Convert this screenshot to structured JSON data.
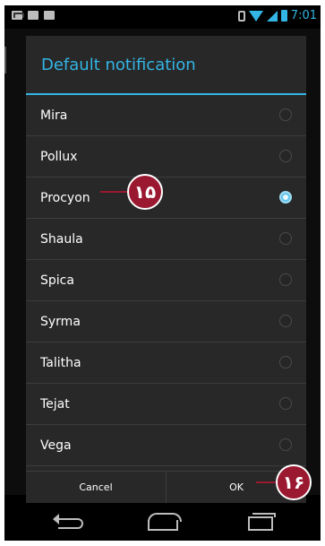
{
  "status_bar": {
    "time": "7:01",
    "left_icons": [
      "gmail-icon",
      "chat-icon",
      "voicemail-icon"
    ],
    "right_icons": [
      "vibrate-icon",
      "wifi-icon",
      "signal-icon",
      "battery-icon"
    ]
  },
  "dialog": {
    "title": "Default notification",
    "items": [
      {
        "label": "Mira",
        "selected": false
      },
      {
        "label": "Pollux",
        "selected": false
      },
      {
        "label": "Procyon",
        "selected": true
      },
      {
        "label": "Shaula",
        "selected": false
      },
      {
        "label": "Spica",
        "selected": false
      },
      {
        "label": "Syrma",
        "selected": false
      },
      {
        "label": "Talitha",
        "selected": false
      },
      {
        "label": "Tejat",
        "selected": false
      },
      {
        "label": "Vega",
        "selected": false
      }
    ],
    "cancel_label": "Cancel",
    "ok_label": "OK"
  },
  "callouts": {
    "first": "۱۵",
    "second": "۱۶"
  },
  "navbar": {
    "icons": [
      "back-icon",
      "home-icon",
      "recent-apps-icon"
    ]
  },
  "colors": {
    "accent": "#33b5e5",
    "dialog_bg": "#282828",
    "callout": "#9a1830"
  }
}
